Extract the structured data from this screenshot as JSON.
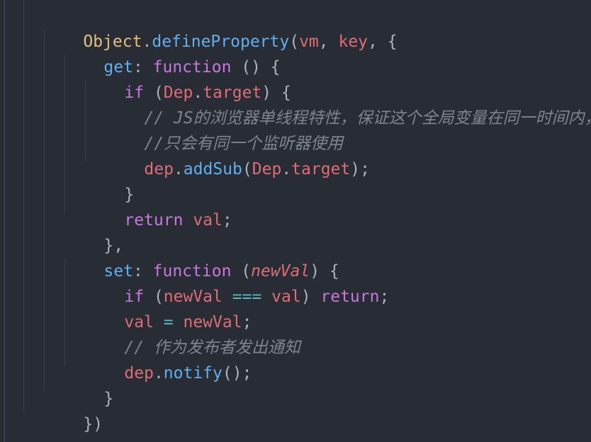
{
  "code": {
    "l1": {
      "obj": "Object",
      "dot": ".",
      "method": "defineProperty",
      "open": "(",
      "a1": "vm",
      "c1": ", ",
      "a2": "key",
      "rest": ", {"
    },
    "l2": {
      "prop": "get",
      "colon": ": ",
      "kw": "function",
      "rest": " () {"
    },
    "l3": {
      "kw": "if",
      "open": " (",
      "obj": "Dep",
      "dot": ".",
      "prop": "target",
      "rest": ") {"
    },
    "l4": {
      "comment": "// JS的浏览器单线程特性，保证这个全局变量在同一时间内，"
    },
    "l5": {
      "comment": "//只会有同一个监听器使用"
    },
    "l6": {
      "obj": "dep",
      "dot": ".",
      "method": "addSub",
      "open": "(",
      "arg": "Dep",
      "dot2": ".",
      "prop": "target",
      "rest": ");"
    },
    "l7": {
      "text": "}"
    },
    "l8": {
      "kw": "return",
      "sp": " ",
      "var": "val",
      "rest": ";"
    },
    "l9": {
      "text": "},"
    },
    "l10": {
      "prop": "set",
      "colon": ": ",
      "kw": "function",
      "open": " (",
      "param": "newVal",
      "rest": ") {"
    },
    "l11": {
      "kw": "if",
      "open": " (",
      "a": "newVal",
      "op": " === ",
      "b": "val",
      "close": ") ",
      "kw2": "return",
      "rest": ";"
    },
    "l12": {
      "a": "val",
      "op": " = ",
      "b": "newVal",
      "rest": ";"
    },
    "l13": {
      "comment": "// 作为发布者发出通知"
    },
    "l14": {
      "obj": "dep",
      "dot": ".",
      "method": "notify",
      "rest": "();"
    },
    "l15": {
      "text": "}"
    },
    "l16": {
      "text": "})"
    },
    "l17": {
      "text": "}"
    }
  },
  "colors": {
    "background": "#282c34",
    "keyword": "#c678dd",
    "function": "#61afef",
    "variable": "#e06c75",
    "class": "#e5c07b",
    "comment": "#7f848e",
    "operator": "#56b6c2",
    "punctuation": "#abb2bf"
  }
}
